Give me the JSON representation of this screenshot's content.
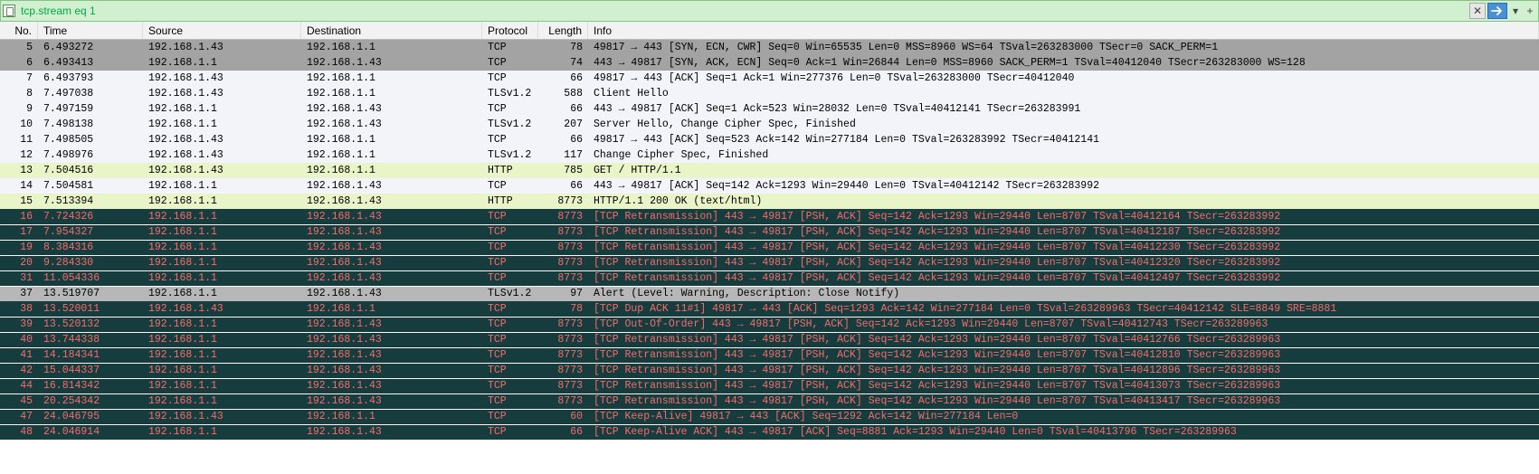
{
  "filter": {
    "text": "tcp.stream eq 1"
  },
  "columns": {
    "no": "No.",
    "time": "Time",
    "source": "Source",
    "destination": "Destination",
    "protocol": "Protocol",
    "length": "Length",
    "info": "Info"
  },
  "packets": [
    {
      "no": 5,
      "time": "6.493272",
      "src": "192.168.1.43",
      "dst": "192.168.1.1",
      "proto": "TCP",
      "len": 78,
      "info": "49817 → 443 [SYN, ECN, CWR] Seq=0 Win=65535 Len=0 MSS=8960 WS=64 TSval=263283000 TSecr=0 SACK_PERM=1",
      "cls": "selected"
    },
    {
      "no": 6,
      "time": "6.493413",
      "src": "192.168.1.1",
      "dst": "192.168.1.43",
      "proto": "TCP",
      "len": 74,
      "info": "443 → 49817 [SYN, ACK, ECN] Seq=0 Ack=1 Win=26844 Len=0 MSS=8960 SACK_PERM=1 TSval=40412040 TSecr=263283000 WS=128",
      "cls": "selected"
    },
    {
      "no": 7,
      "time": "6.493793",
      "src": "192.168.1.43",
      "dst": "192.168.1.1",
      "proto": "TCP",
      "len": 66,
      "info": "49817 → 443 [ACK] Seq=1 Ack=1 Win=277376 Len=0 TSval=263283000 TSecr=40412040",
      "cls": "normal"
    },
    {
      "no": 8,
      "time": "7.497038",
      "src": "192.168.1.43",
      "dst": "192.168.1.1",
      "proto": "TLSv1.2",
      "len": 588,
      "info": "Client Hello",
      "cls": "normal"
    },
    {
      "no": 9,
      "time": "7.497159",
      "src": "192.168.1.1",
      "dst": "192.168.1.43",
      "proto": "TCP",
      "len": 66,
      "info": "443 → 49817 [ACK] Seq=1 Ack=523 Win=28032 Len=0 TSval=40412141 TSecr=263283991",
      "cls": "normal"
    },
    {
      "no": 10,
      "time": "7.498138",
      "src": "192.168.1.1",
      "dst": "192.168.1.43",
      "proto": "TLSv1.2",
      "len": 207,
      "info": "Server Hello, Change Cipher Spec, Finished",
      "cls": "normal"
    },
    {
      "no": 11,
      "time": "7.498505",
      "src": "192.168.1.43",
      "dst": "192.168.1.1",
      "proto": "TCP",
      "len": 66,
      "info": "49817 → 443 [ACK] Seq=523 Ack=142 Win=277184 Len=0 TSval=263283992 TSecr=40412141",
      "cls": "normal"
    },
    {
      "no": 12,
      "time": "7.498976",
      "src": "192.168.1.43",
      "dst": "192.168.1.1",
      "proto": "TLSv1.2",
      "len": 117,
      "info": "Change Cipher Spec, Finished",
      "cls": "normal"
    },
    {
      "no": 13,
      "time": "7.504516",
      "src": "192.168.1.43",
      "dst": "192.168.1.1",
      "proto": "HTTP",
      "len": 785,
      "info": "GET / HTTP/1.1",
      "cls": "http"
    },
    {
      "no": 14,
      "time": "7.504581",
      "src": "192.168.1.1",
      "dst": "192.168.1.43",
      "proto": "TCP",
      "len": 66,
      "info": "443 → 49817 [ACK] Seq=142 Ack=1293 Win=29440 Len=0 TSval=40412142 TSecr=263283992",
      "cls": "normal"
    },
    {
      "no": 15,
      "time": "7.513394",
      "src": "192.168.1.1",
      "dst": "192.168.1.43",
      "proto": "HTTP",
      "len": 8773,
      "info": "HTTP/1.1 200 OK  (text/html)",
      "cls": "http"
    },
    {
      "no": 16,
      "time": "7.724326",
      "src": "192.168.1.1",
      "dst": "192.168.1.43",
      "proto": "TCP",
      "len": 8773,
      "info": "[TCP Retransmission] 443 → 49817 [PSH, ACK] Seq=142 Ack=1293 Win=29440 Len=8707 TSval=40412164 TSecr=263283992",
      "cls": "dark"
    },
    {
      "no": 17,
      "time": "7.954327",
      "src": "192.168.1.1",
      "dst": "192.168.1.43",
      "proto": "TCP",
      "len": 8773,
      "info": "[TCP Retransmission] 443 → 49817 [PSH, ACK] Seq=142 Ack=1293 Win=29440 Len=8707 TSval=40412187 TSecr=263283992",
      "cls": "dark"
    },
    {
      "no": 19,
      "time": "8.384316",
      "src": "192.168.1.1",
      "dst": "192.168.1.43",
      "proto": "TCP",
      "len": 8773,
      "info": "[TCP Retransmission] 443 → 49817 [PSH, ACK] Seq=142 Ack=1293 Win=29440 Len=8707 TSval=40412230 TSecr=263283992",
      "cls": "dark"
    },
    {
      "no": 20,
      "time": "9.284330",
      "src": "192.168.1.1",
      "dst": "192.168.1.43",
      "proto": "TCP",
      "len": 8773,
      "info": "[TCP Retransmission] 443 → 49817 [PSH, ACK] Seq=142 Ack=1293 Win=29440 Len=8707 TSval=40412320 TSecr=263283992",
      "cls": "dark"
    },
    {
      "no": 31,
      "time": "11.054336",
      "src": "192.168.1.1",
      "dst": "192.168.1.43",
      "proto": "TCP",
      "len": 8773,
      "info": "[TCP Retransmission] 443 → 49817 [PSH, ACK] Seq=142 Ack=1293 Win=29440 Len=8707 TSval=40412497 TSecr=263283992",
      "cls": "dark"
    },
    {
      "no": 37,
      "time": "13.519707",
      "src": "192.168.1.1",
      "dst": "192.168.1.43",
      "proto": "TLSv1.2",
      "len": 97,
      "info": "Alert (Level: Warning, Description: Close Notify)",
      "cls": "graysel"
    },
    {
      "no": 38,
      "time": "13.520011",
      "src": "192.168.1.43",
      "dst": "192.168.1.1",
      "proto": "TCP",
      "len": 78,
      "info": "[TCP Dup ACK 11#1] 49817 → 443 [ACK] Seq=1293 Ack=142 Win=277184 Len=0 TSval=263289963 TSecr=40412142 SLE=8849 SRE=8881",
      "cls": "dark"
    },
    {
      "no": 39,
      "time": "13.520132",
      "src": "192.168.1.1",
      "dst": "192.168.1.43",
      "proto": "TCP",
      "len": 8773,
      "info": "[TCP Out-Of-Order] 443 → 49817 [PSH, ACK] Seq=142 Ack=1293 Win=29440 Len=8707 TSval=40412743 TSecr=263289963",
      "cls": "dark"
    },
    {
      "no": 40,
      "time": "13.744338",
      "src": "192.168.1.1",
      "dst": "192.168.1.43",
      "proto": "TCP",
      "len": 8773,
      "info": "[TCP Retransmission] 443 → 49817 [PSH, ACK] Seq=142 Ack=1293 Win=29440 Len=8707 TSval=40412766 TSecr=263289963",
      "cls": "dark"
    },
    {
      "no": 41,
      "time": "14.184341",
      "src": "192.168.1.1",
      "dst": "192.168.1.43",
      "proto": "TCP",
      "len": 8773,
      "info": "[TCP Retransmission] 443 → 49817 [PSH, ACK] Seq=142 Ack=1293 Win=29440 Len=8707 TSval=40412810 TSecr=263289963",
      "cls": "dark"
    },
    {
      "no": 42,
      "time": "15.044337",
      "src": "192.168.1.1",
      "dst": "192.168.1.43",
      "proto": "TCP",
      "len": 8773,
      "info": "[TCP Retransmission] 443 → 49817 [PSH, ACK] Seq=142 Ack=1293 Win=29440 Len=8707 TSval=40412896 TSecr=263289963",
      "cls": "dark"
    },
    {
      "no": 44,
      "time": "16.814342",
      "src": "192.168.1.1",
      "dst": "192.168.1.43",
      "proto": "TCP",
      "len": 8773,
      "info": "[TCP Retransmission] 443 → 49817 [PSH, ACK] Seq=142 Ack=1293 Win=29440 Len=8707 TSval=40413073 TSecr=263289963",
      "cls": "dark"
    },
    {
      "no": 45,
      "time": "20.254342",
      "src": "192.168.1.1",
      "dst": "192.168.1.43",
      "proto": "TCP",
      "len": 8773,
      "info": "[TCP Retransmission] 443 → 49817 [PSH, ACK] Seq=142 Ack=1293 Win=29440 Len=8707 TSval=40413417 TSecr=263289963",
      "cls": "dark"
    },
    {
      "no": 47,
      "time": "24.046795",
      "src": "192.168.1.43",
      "dst": "192.168.1.1",
      "proto": "TCP",
      "len": 60,
      "info": "[TCP Keep-Alive] 49817 → 443 [ACK] Seq=1292 Ack=142 Win=277184 Len=0",
      "cls": "dark"
    },
    {
      "no": 48,
      "time": "24.046914",
      "src": "192.168.1.1",
      "dst": "192.168.1.43",
      "proto": "TCP",
      "len": 66,
      "info": "[TCP Keep-Alive ACK] 443 → 49817 [ACK] Seq=8881 Ack=1293 Win=29440 Len=0 TSval=40413796 TSecr=263289963",
      "cls": "dark"
    }
  ]
}
